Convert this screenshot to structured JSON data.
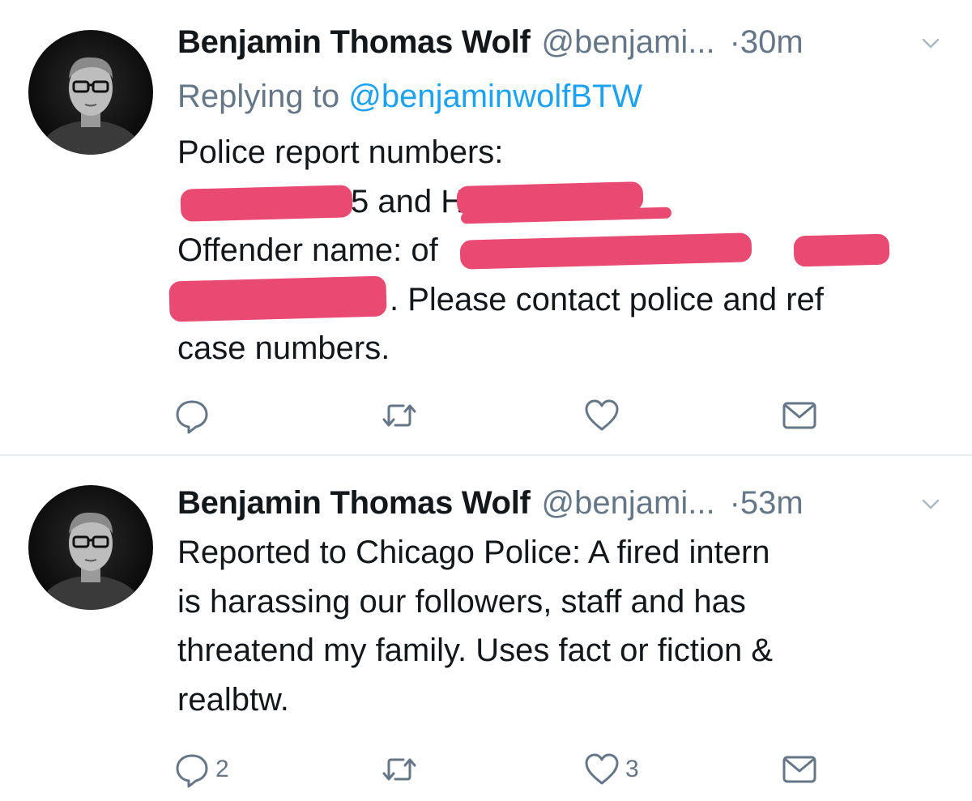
{
  "tweets": [
    {
      "author_name": "Benjamin Thomas Wolf",
      "handle": "@benjami...",
      "time": "·30m",
      "replying_prefix": "Replying to",
      "replying_handle": "@benjaminwolfBTW",
      "lines": [
        "Police report numbers:",
        "5 and H",
        "Offender name:                                     of",
        ". Please contact police and ref",
        "case numbers."
      ],
      "reply_count": "",
      "retweet_count": "",
      "like_count": ""
    },
    {
      "author_name": "Benjamin Thomas Wolf",
      "handle": "@benjami...",
      "time": "·53m",
      "lines": [
        "Reported to Chicago Police: A fired intern",
        "is harassing our followers, staff and has",
        "threatend my family. Uses fact or fiction &",
        "realbtw."
      ],
      "reply_count": "2",
      "retweet_count": "",
      "like_count": "3"
    }
  ],
  "icons": {
    "reply": "reply-icon",
    "retweet": "retweet-icon",
    "like": "heart-icon",
    "dm": "envelope-icon",
    "caret": "chevron-down-icon"
  },
  "colors": {
    "link": "#1da1f2",
    "secondary_text": "#657786",
    "redaction": "#e84a72",
    "divider": "#e6ecf0"
  }
}
